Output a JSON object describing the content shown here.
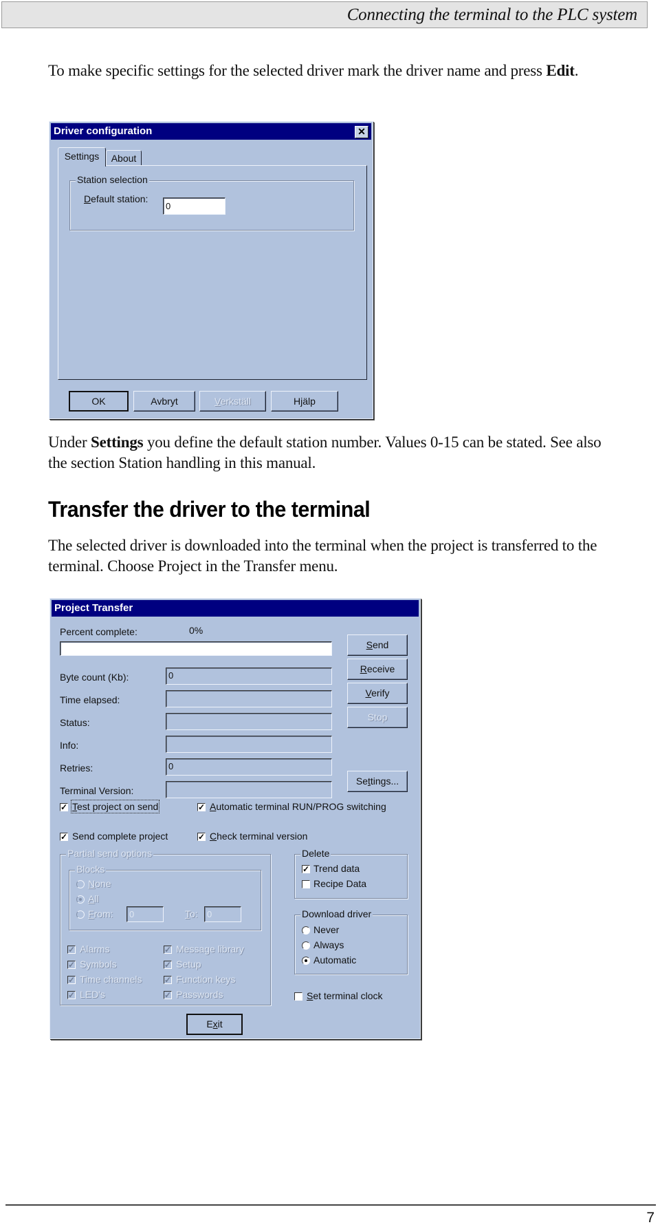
{
  "header": {
    "title": "Connecting the terminal to the PLC system"
  },
  "intro": {
    "text_before": "To make specific settings for the selected driver mark the driver name and press ",
    "bold": "Edit",
    "text_after": "."
  },
  "driver_dialog": {
    "title": "Driver configuration",
    "close_icon": "close-icon",
    "tabs": [
      {
        "label": "Settings",
        "active": true
      },
      {
        "label": "About",
        "active": false
      }
    ],
    "group_title": "Station selection",
    "default_station_label_u": "D",
    "default_station_label_rest": "efault station:",
    "default_station_value": "0",
    "buttons": {
      "ok": "OK",
      "cancel": "Avbryt",
      "apply_u": "V",
      "apply_rest": "erkställ",
      "help": "Hjälp"
    }
  },
  "settings_para": {
    "text_before": "Under ",
    "bold": "Settings",
    "text_after": " you define the default station number. Values 0-15 can be stated. See also the section Station handling in this manual."
  },
  "section": {
    "heading": "Transfer the driver to the terminal",
    "body": "The selected driver is downloaded into the terminal when the project is transferred to the terminal. Choose Project in the Transfer menu."
  },
  "project_dialog": {
    "title": "Project Transfer",
    "percent_label": "Percent complete:",
    "percent_value": "0%",
    "progress_fraction": 0,
    "fields": [
      {
        "label": "Byte count (Kb):",
        "value": "0"
      },
      {
        "label": "Time elapsed:",
        "value": ""
      },
      {
        "label": "Status:",
        "value": ""
      },
      {
        "label": "Info:",
        "value": ""
      },
      {
        "label": "Retries:",
        "value": "0"
      },
      {
        "label": "Terminal Version:",
        "value": ""
      }
    ],
    "buttons": {
      "send_u": "S",
      "send_rest": "end",
      "receive_u": "R",
      "receive_rest": "eceive",
      "verify_u": "V",
      "verify_rest": "erify",
      "stop": "Stop",
      "settings_a": "Se",
      "settings_u": "t",
      "settings_b": "tings...",
      "exit_a": "E",
      "exit_u": "x",
      "exit_b": "it"
    },
    "options": {
      "test_project_u": "T",
      "test_project_rest": "est project on send",
      "test_project_checked": true,
      "auto_switch_u": "A",
      "auto_switch_rest": "utomatic terminal RUN/PROG switching",
      "auto_switch_checked": true,
      "send_complete": "Send complete project",
      "send_complete_checked": true,
      "check_version_u": "C",
      "check_version_rest": "heck terminal version",
      "check_version_checked": true
    },
    "partial": {
      "title": "Partial send options",
      "blocks_title": "Blocks",
      "none_u": "N",
      "none_rest": "one",
      "all_u": "A",
      "all_rest": "ll",
      "from_u": "F",
      "from_rest": "rom:",
      "from_value": "0",
      "to_u": "T",
      "to_rest": "o:",
      "to_value": "0",
      "selected_block": "All",
      "items_left": [
        "Alarms",
        "Symbols",
        "Time channels",
        "LED's"
      ],
      "items_right": [
        "Message library",
        "Setup",
        "Function keys",
        "Passwords"
      ]
    },
    "delete": {
      "title": "Delete",
      "trend": "Trend data",
      "trend_checked": true,
      "recipe": "Recipe Data",
      "recipe_checked": false
    },
    "download": {
      "title": "Download driver",
      "never": "Never",
      "always": "Always",
      "automatic": "Automatic",
      "selected": "Automatic"
    },
    "clock_u": "S",
    "clock_rest": "et terminal clock",
    "clock_checked": false
  },
  "footer": {
    "page_number": "7"
  }
}
